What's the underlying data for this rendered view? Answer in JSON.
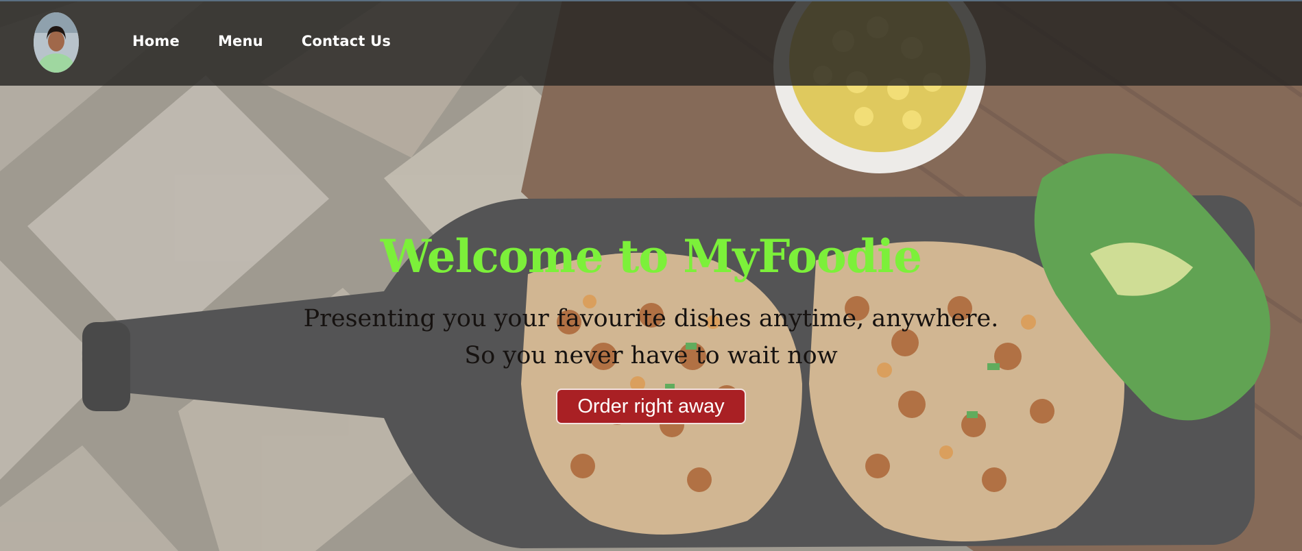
{
  "nav": {
    "links": [
      "Home",
      "Menu",
      "Contact Us"
    ]
  },
  "hero": {
    "title": "Welcome to MyFoodie",
    "tagline_line1": "Presenting you your favourite dishes anytime, anywhere.",
    "tagline_line2": "So you never have to wait now",
    "cta_label": "Order right away"
  },
  "colors": {
    "title": "#7cf03a",
    "cta": "#a92024",
    "navbar": "#262422"
  },
  "icons": [
    "profile-avatar"
  ]
}
